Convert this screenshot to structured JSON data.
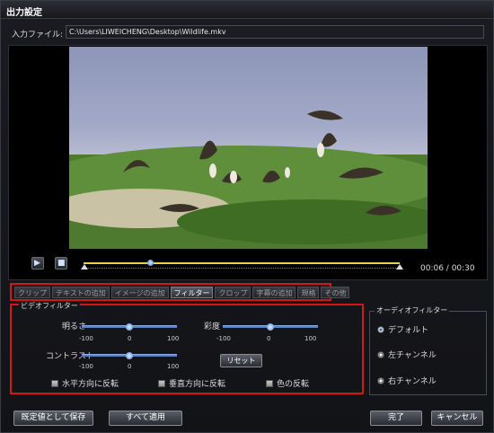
{
  "window": {
    "title": "出力設定"
  },
  "input": {
    "label": "入力ファイル:",
    "path": "C:\\Users\\LIWEICHENG\\Desktop\\Wildlife.mkv"
  },
  "player": {
    "time": "00:06 / 00:30",
    "progress": 0.21
  },
  "tabs": [
    {
      "label": "クリップ"
    },
    {
      "label": "テキストの追加"
    },
    {
      "label": "イメージの追加"
    },
    {
      "label": "フィルター"
    },
    {
      "label": "クロップ"
    },
    {
      "label": "字幕の追加"
    },
    {
      "label": "規格"
    },
    {
      "label": "その他"
    }
  ],
  "active_tab": "フィルター",
  "video_filter": {
    "title": "ビデオフィルター",
    "brightness": {
      "label": "明るさ",
      "min": "-100",
      "mid": "0",
      "max": "100",
      "value": 0
    },
    "saturation": {
      "label": "彩度",
      "min": "-100",
      "mid": "0",
      "max": "100",
      "value": 0
    },
    "contrast": {
      "label": "コントラスト",
      "min": "-100",
      "mid": "0",
      "max": "100",
      "value": 0
    },
    "reset_label": "リセット",
    "flip_horizontal": "水平方向に反転",
    "flip_vertical": "垂直方向に反転",
    "invert_color": "色の反転"
  },
  "audio_filter": {
    "title": "オーディオフィルター",
    "options": [
      {
        "label": "デフォルト",
        "selected": true
      },
      {
        "label": "左チャンネル",
        "selected": false
      },
      {
        "label": "右チャンネル",
        "selected": false
      }
    ]
  },
  "buttons": {
    "save_default": "既定値として保存",
    "apply_all": "すべて適用",
    "ok": "完了",
    "cancel": "キャンセル"
  },
  "colors": {
    "highlight_border": "#d01818",
    "timeline": "#e3d54a",
    "slider": "#5b7fc0"
  }
}
